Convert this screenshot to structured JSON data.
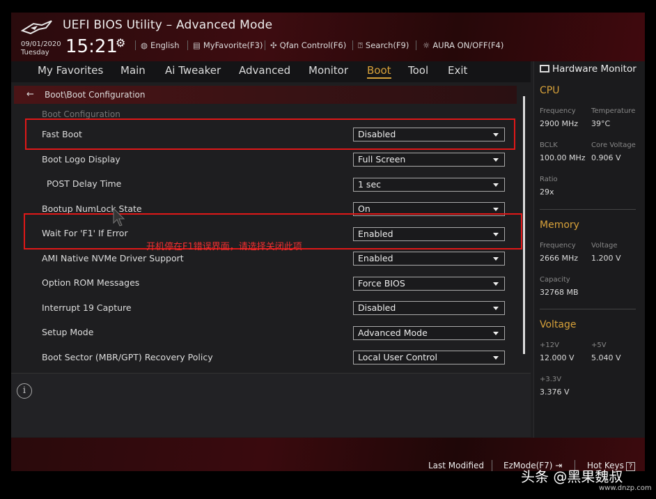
{
  "header": {
    "title": "UEFI BIOS Utility – Advanced Mode",
    "date": "09/01/2020",
    "day": "Tuesday",
    "time": "15:21",
    "items": [
      {
        "icon": "globe-icon",
        "label": "English"
      },
      {
        "icon": "favorite-icon",
        "label": "MyFavorite(F3)"
      },
      {
        "icon": "fan-icon",
        "label": "Qfan Control(F6)"
      },
      {
        "icon": "search-icon",
        "label": "Search(F9)"
      },
      {
        "icon": "aura-icon",
        "label": "AURA ON/OFF(F4)"
      }
    ]
  },
  "nav": {
    "tabs": [
      "My Favorites",
      "Main",
      "Ai Tweaker",
      "Advanced",
      "Monitor",
      "Boot",
      "Tool",
      "Exit"
    ],
    "active": "Boot"
  },
  "main": {
    "breadcrumb": "Boot\\Boot Configuration",
    "section": "Boot Configuration",
    "rows": [
      {
        "label": "Fast Boot",
        "value": "Disabled"
      },
      {
        "label": "Boot Logo Display",
        "value": "Full Screen"
      },
      {
        "label": "POST Delay Time",
        "value": "1 sec"
      },
      {
        "label": "Bootup NumLock State",
        "value": "On"
      },
      {
        "label": "Wait For 'F1' If Error",
        "value": "Enabled"
      },
      {
        "label": "AMI Native NVMe Driver Support",
        "value": "Enabled"
      },
      {
        "label": "Option ROM Messages",
        "value": "Force BIOS"
      },
      {
        "label": "Interrupt 19 Capture",
        "value": "Disabled"
      },
      {
        "label": "Setup Mode",
        "value": "Advanced Mode"
      },
      {
        "label": "Boot Sector (MBR/GPT) Recovery Policy",
        "value": "Local User Control"
      }
    ],
    "annotation": "开机停在F1错误界面，请选择关闭此项",
    "annotation_color": "#e01818"
  },
  "hardware_monitor": {
    "title": "Hardware Monitor",
    "cpu": {
      "heading": "CPU",
      "frequency_label": "Frequency",
      "frequency": "2900 MHz",
      "temperature_label": "Temperature",
      "temperature": "39°C",
      "bclk_label": "BCLK",
      "bclk": "100.00 MHz",
      "core_voltage_label": "Core Voltage",
      "core_voltage": "0.906 V",
      "ratio_label": "Ratio",
      "ratio": "29x"
    },
    "memory": {
      "heading": "Memory",
      "frequency_label": "Frequency",
      "frequency": "2666 MHz",
      "voltage_label": "Voltage",
      "voltage": "1.200 V",
      "capacity_label": "Capacity",
      "capacity": "32768 MB"
    },
    "voltage": {
      "heading": "Voltage",
      "v12_label": "+12V",
      "v12": "12.000 V",
      "v5_label": "+5V",
      "v5": "5.040 V",
      "v33_label": "+3.3V",
      "v33": "3.376 V"
    }
  },
  "footer": {
    "last_modified": "Last Modified",
    "ezmode": "EzMode(F7)",
    "hotkeys": "Hot Keys",
    "hotkeys_key": "?"
  },
  "watermark": {
    "text": "头条 @黑果魏叔",
    "site": "www.dnzp.com"
  },
  "colors": {
    "accent": "#d8a23a",
    "annotation": "#e01818"
  }
}
